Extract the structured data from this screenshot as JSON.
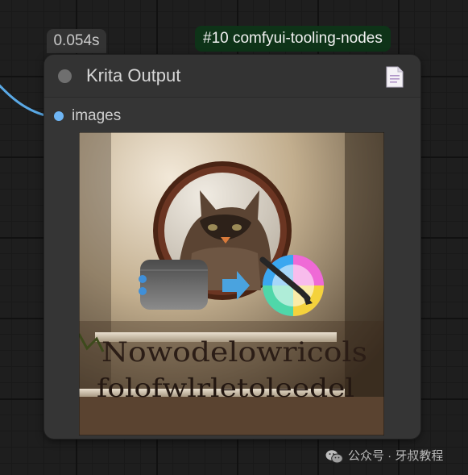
{
  "canvas": {
    "exec_time": "0.054s",
    "node_badge": "#10 comfyui-tooling-nodes"
  },
  "node": {
    "title": "Krita Output",
    "input_slot": "images",
    "output_image_text": [
      "Nowodelowricols",
      "folofwlrletoleedel"
    ]
  },
  "watermark": {
    "text": "公众号 · 牙叔教程"
  },
  "colors": {
    "wire": "#5aa9e6",
    "slot": "#6fb6f5",
    "badge_bg": "#0e3318",
    "node_bg": "#353535"
  }
}
